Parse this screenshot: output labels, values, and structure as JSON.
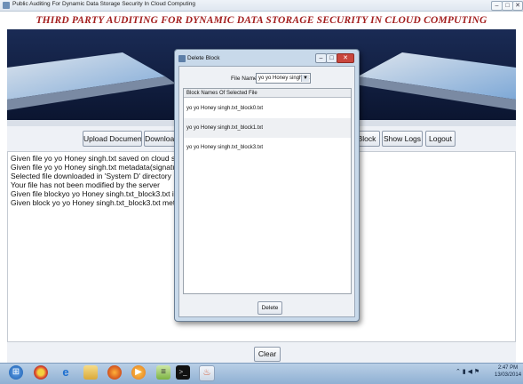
{
  "window": {
    "title": "Public Auditing For Dynamic Data Storage Security In Cloud Computing",
    "minimize": "–",
    "maximize": "□",
    "close": "✕"
  },
  "banner": {
    "title": "THIRD PARTY AUDITING FOR DYNAMIC DATA STORAGE SECURITY IN CLOUD COMPUTING"
  },
  "toolbar": {
    "upload": "Upload Document",
    "download": "Download",
    "block": "Block",
    "show_logs": "Show Logs",
    "logout": "Logout"
  },
  "log": {
    "lines": [
      "Given file yo yo Honey singh.txt saved on cloud server",
      "Given file yo yo Honey singh.txt metadata(signature) saved",
      "Selected file downloaded in 'System D' directory",
      "Your file has not been modified by the server",
      "Given file blockyo yo Honey singh.txt_block3.txt inserted o",
      "Given block yo yo Honey singh.txt_block3.txt metadata(si"
    ]
  },
  "clear_button": "Clear",
  "dialog": {
    "title": "Delete Block",
    "file_name_label": "File Name",
    "file_name_value": "yo yo Honey singh.txt",
    "table_header": "Block Names Of Selected File",
    "rows": [
      "yo yo Honey singh.txt_block0.txt",
      "yo yo Honey singh.txt_block1.txt",
      "yo yo Honey singh.txt_block3.txt"
    ],
    "delete_button": "Delete"
  },
  "taskbar": {
    "time": "2:47 PM",
    "date": "13/03/2014",
    "icons": [
      "start-orb",
      "chrome",
      "internet-explorer",
      "folder",
      "firefox",
      "media-player",
      "notepad",
      "command-prompt",
      "java"
    ]
  },
  "colors": {
    "banner_title": "#a31e1e",
    "dialog_frame": "#c8d9ea",
    "taskbar": "#a6c2e0"
  }
}
